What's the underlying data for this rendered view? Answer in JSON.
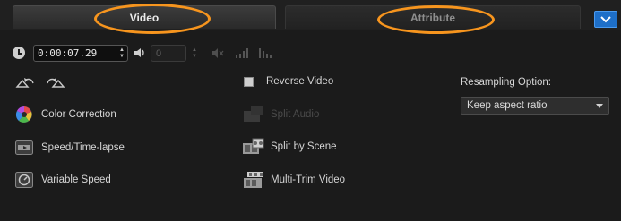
{
  "tabs": [
    {
      "label": "Video",
      "active": true
    },
    {
      "label": "Attribute",
      "active": false
    }
  ],
  "collapse_button": {
    "icon": "chevron-down-icon"
  },
  "timecode": {
    "value": "0:00:07.29",
    "icon": "clock-icon"
  },
  "volume": {
    "value": "0",
    "icon": "speaker-icon",
    "enabled": false
  },
  "audio_icons": [
    "mute-icon",
    "fade-in-icon",
    "fade-out-icon"
  ],
  "rotate": {
    "left_icon": "rotate-left-icon",
    "right_icon": "rotate-right-icon"
  },
  "left_tools": [
    {
      "label": "Color Correction",
      "icon": "color-wheel-icon"
    },
    {
      "label": "Speed/Time-lapse",
      "icon": "speed-icon"
    },
    {
      "label": "Variable Speed",
      "icon": "variable-speed-icon"
    }
  ],
  "reverse_video": {
    "label": "Reverse Video",
    "checked": false
  },
  "mid_tools": [
    {
      "label": "Split Audio",
      "icon": "split-audio-icon",
      "enabled": false
    },
    {
      "label": "Split by Scene",
      "icon": "split-scene-icon",
      "enabled": true
    },
    {
      "label": "Multi-Trim Video",
      "icon": "multi-trim-icon",
      "enabled": true
    }
  ],
  "resampling": {
    "label": "Resampling Option:",
    "selected": "Keep aspect ratio"
  },
  "colors": {
    "annotation": "#f7951e",
    "accent": "#1e6fc8",
    "background": "#1b1b1b"
  }
}
